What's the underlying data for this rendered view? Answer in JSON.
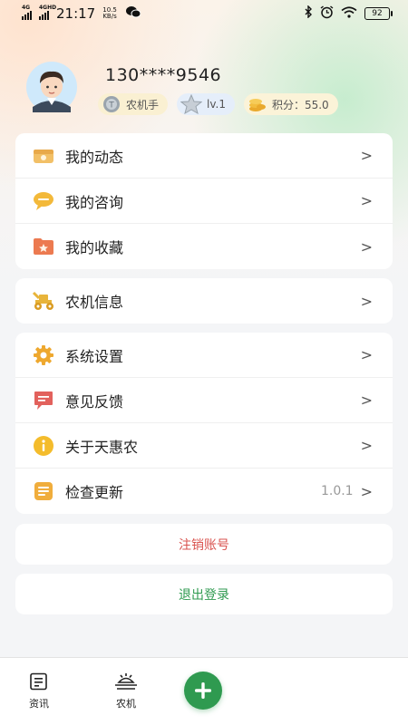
{
  "status_bar": {
    "net1": "4G",
    "net2": "4GHD",
    "time": "21:17",
    "speed_value": "10.5",
    "speed_unit": "KB/s",
    "battery": "92"
  },
  "profile": {
    "phone": "130****9546",
    "role": "农机手",
    "level": "lv.1",
    "points": "积分：55.0"
  },
  "menu_group_1": [
    {
      "label": "我的动态",
      "icon": "activity-icon"
    },
    {
      "label": "我的咨询",
      "icon": "chat-bubble-icon"
    },
    {
      "label": "我的收藏",
      "icon": "star-folder-icon"
    }
  ],
  "menu_group_2": [
    {
      "label": "农机信息",
      "icon": "tractor-icon"
    }
  ],
  "menu_group_3": [
    {
      "label": "系统设置",
      "icon": "gear-icon"
    },
    {
      "label": "意见反馈",
      "icon": "feedback-icon"
    },
    {
      "label": "关于天惠农",
      "icon": "info-icon"
    },
    {
      "label": "检查更新",
      "icon": "update-icon",
      "value": "1.0.1"
    }
  ],
  "chevron": ">",
  "actions": {
    "cancel_account": "注销账号",
    "logout": "退出登录"
  },
  "tabbar": {
    "news": "资讯",
    "machinery": "农机",
    "add": "+"
  },
  "colors": {
    "accent_green": "#2f9a50",
    "danger_red": "#d9534f",
    "icon_orange": "#f0b03a"
  }
}
